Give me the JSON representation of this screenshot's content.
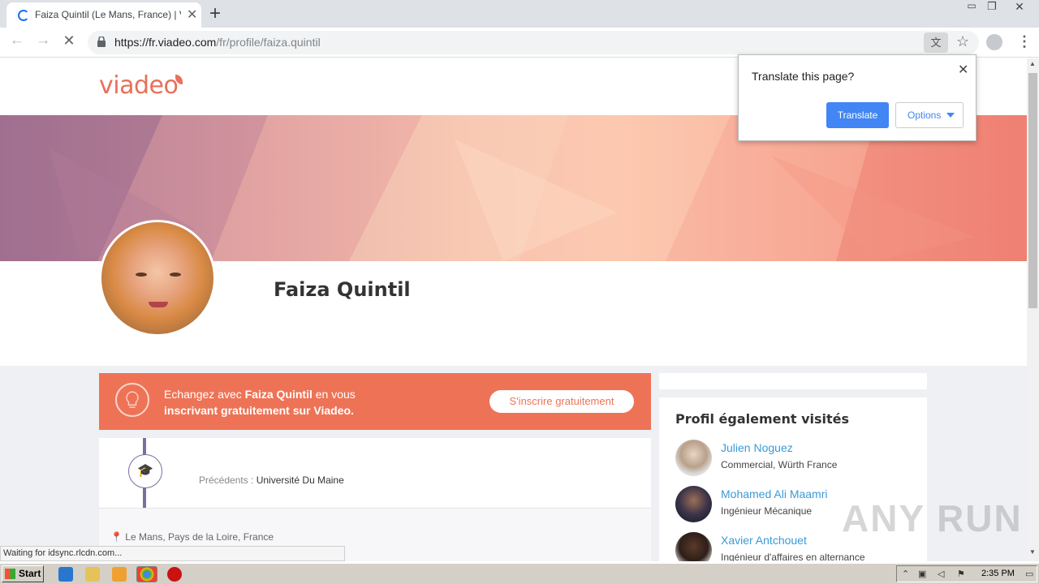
{
  "browser": {
    "tab_title": "Faiza Quintil (Le Mans, France) | Via",
    "url_host": "https://fr.viadeo.com",
    "url_path": "/fr/profile/faiza.quintil",
    "status_text": "Waiting for idsync.rlcdn.com..."
  },
  "translate_popup": {
    "question": "Translate this page?",
    "translate_label": "Translate",
    "options_label": "Options"
  },
  "site": {
    "logo": "viadeo",
    "profile_name": "Faiza Quintil",
    "cta_line1_prefix": "Echangez avec ",
    "cta_line1_name": "Faiza Quintil",
    "cta_line1_suffix": " en vous",
    "cta_line2": "inscrivant gratuitement sur Viadeo.",
    "cta_button": "S'inscrire gratuitement",
    "edu_label": "Précédents : ",
    "edu_school": "Université Du Maine",
    "location": "Le Mans, Pays de la Loire, France"
  },
  "sidebar": {
    "title": "Profil également visités",
    "visitors": [
      {
        "name": "Julien Noguez",
        "role": "Commercial, Würth France"
      },
      {
        "name": "Mohamed Ali Maamri",
        "role": "Ingénieur Mécanique"
      },
      {
        "name": "Xavier Antchouet",
        "role": "Ingénieur d'affaires en alternance"
      }
    ]
  },
  "watermark": "ANY RUN",
  "taskbar": {
    "start_label": "Start",
    "clock": "2:35 PM"
  },
  "colors": {
    "brand": "#e8705a",
    "cta": "#ee7356",
    "link": "#3a9bd7",
    "translate_button": "#4285f4"
  }
}
